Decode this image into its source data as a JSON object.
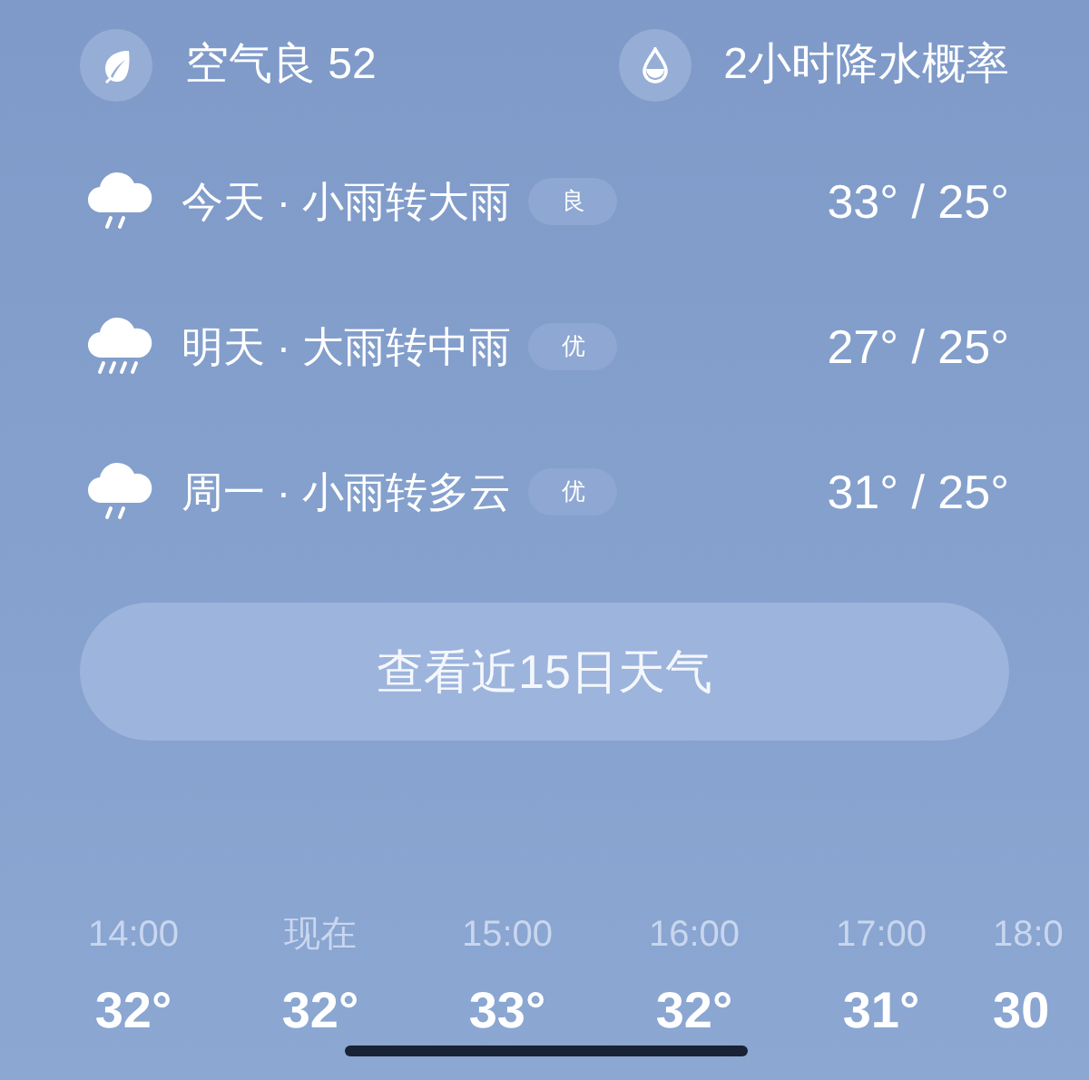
{
  "summary": [
    {
      "kind": "air",
      "label": "空气良 52"
    },
    {
      "kind": "rain",
      "label": "2小时降水概率"
    }
  ],
  "days": [
    {
      "kind": "light_rain",
      "label": "今天 · 小雨转大雨",
      "aqi": "良",
      "temps": "33° / 25°"
    },
    {
      "kind": "heavy_rain",
      "label": "明天 · 大雨转中雨",
      "aqi": "优",
      "temps": "27° / 25°"
    },
    {
      "kind": "light_rain",
      "label": "周一 · 小雨转多云",
      "aqi": "优",
      "temps": "31° / 25°"
    }
  ],
  "forecast_button": "查看近15日天气",
  "hourly": [
    {
      "time": "14:00",
      "temp": "32°"
    },
    {
      "time": "现在",
      "temp": "32°"
    },
    {
      "time": "15:00",
      "temp": "33°"
    },
    {
      "time": "16:00",
      "temp": "32°"
    },
    {
      "time": "17:00",
      "temp": "31°"
    },
    {
      "time": "18:0",
      "temp": "30"
    }
  ]
}
